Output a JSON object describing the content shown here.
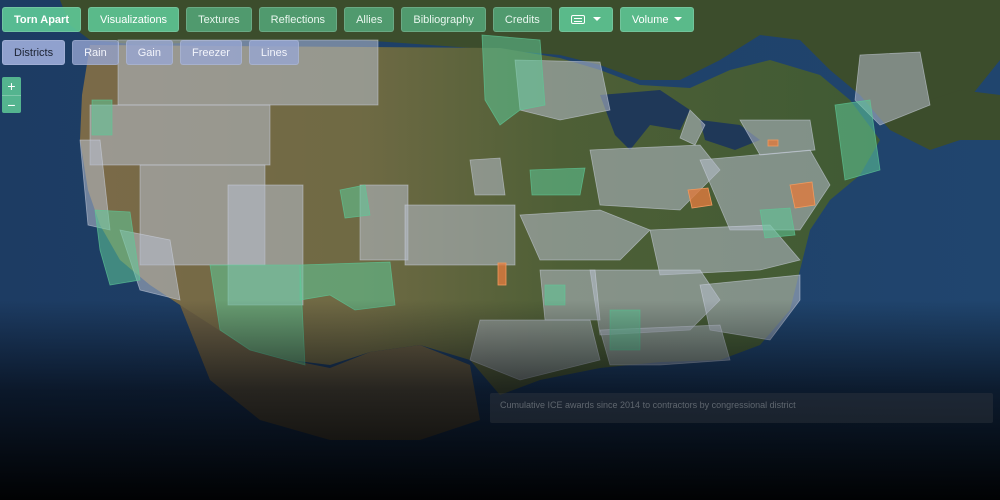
{
  "nav": {
    "brand": "Torn Apart",
    "items": [
      {
        "label": "Visualizations",
        "active": true
      },
      {
        "label": "Textures"
      },
      {
        "label": "Reflections"
      },
      {
        "label": "Allies"
      },
      {
        "label": "Bibliography"
      },
      {
        "label": "Credits"
      }
    ],
    "captions_icon": "closed-captions-icon",
    "volume_label": "Volume"
  },
  "layers": {
    "items": [
      {
        "label": "Districts",
        "active": true
      },
      {
        "label": "Rain"
      },
      {
        "label": "Gain"
      },
      {
        "label": "Freezer"
      },
      {
        "label": "Lines"
      }
    ]
  },
  "zoom": {
    "in": "+",
    "out": "−"
  },
  "caption": {
    "text": "Cumulative ICE awards since 2014 to contractors by congressional district"
  },
  "colors": {
    "accent": "#5ec997",
    "layer": "#97a7d4",
    "district_fill": "#b7bdcc",
    "district_highlight": "#5ec997",
    "district_hotspot": "#e07a3f"
  }
}
